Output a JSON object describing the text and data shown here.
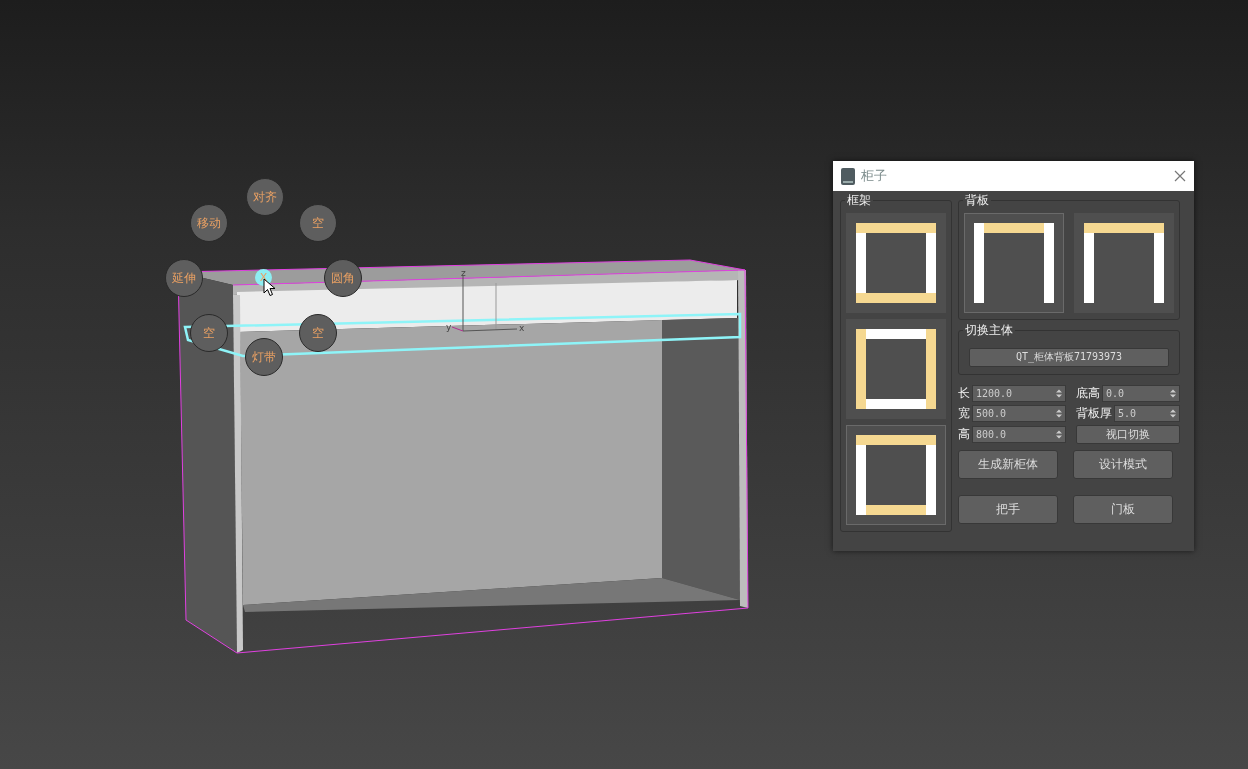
{
  "viewport": {
    "gizmo_axes": [
      "z",
      "y",
      "x"
    ],
    "radial_menu": {
      "center": "X",
      "items": [
        {
          "label": "对齐"
        },
        {
          "label": "移动"
        },
        {
          "label": "空"
        },
        {
          "label": "延伸"
        },
        {
          "label": "圆角"
        },
        {
          "label": "空"
        },
        {
          "label": "空"
        },
        {
          "label": "灯带"
        }
      ]
    }
  },
  "dialog": {
    "title": "柜子",
    "frame": {
      "title": "框架",
      "options": [
        {
          "kind": "caps-over-sides",
          "selected": false
        },
        {
          "kind": "sides-over-caps",
          "selected": false
        },
        {
          "kind": "top-over-sides-over-bottom",
          "selected": true
        }
      ]
    },
    "back": {
      "title": "背板",
      "options": [
        {
          "kind": "top-between-sides",
          "selected": true
        },
        {
          "kind": "top-over-sides",
          "selected": false
        }
      ]
    },
    "body": {
      "title": "切换主体",
      "button": "QT_柜体背板71793973"
    },
    "fields_left": [
      {
        "label": "长",
        "value": "1200.0"
      },
      {
        "label": "宽",
        "value": "500.0"
      },
      {
        "label": "高",
        "value": "800.0"
      }
    ],
    "fields_right": [
      {
        "label": "底高",
        "value": "0.0"
      },
      {
        "label": "背板厚",
        "value": "5.0"
      }
    ],
    "view_button": "视口切换",
    "buttons": [
      "生成新柜体",
      "设计模式",
      "把手",
      "门板"
    ]
  }
}
